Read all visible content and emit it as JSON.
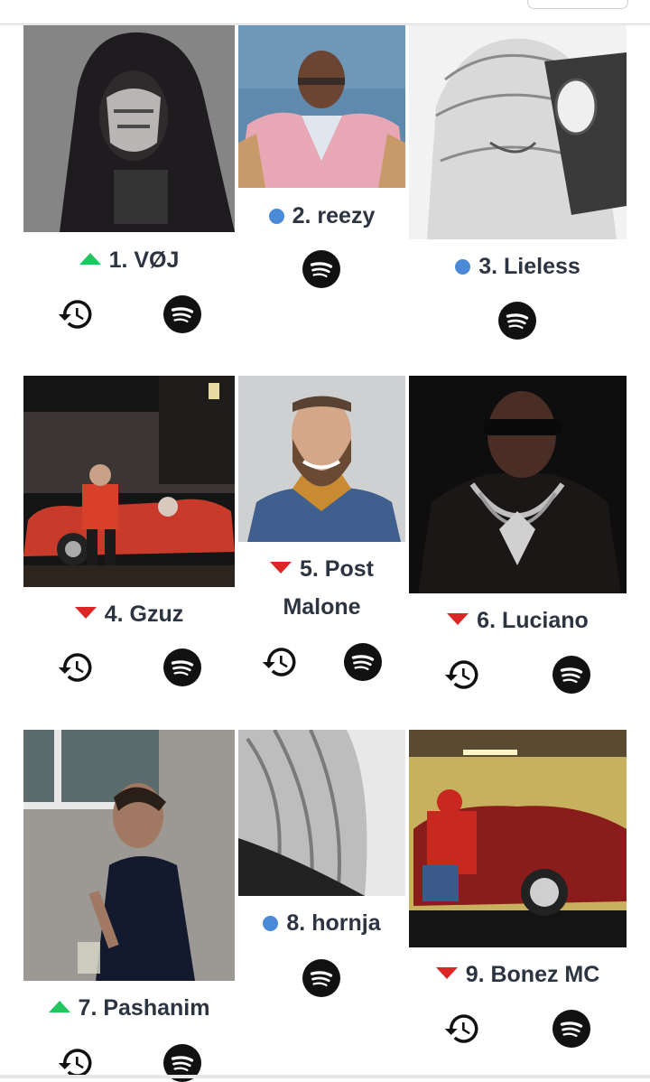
{
  "colors": {
    "trend_up": "#22c55e",
    "trend_down": "#dc2626",
    "trend_same": "#4a8ad6",
    "label_text": "#2b3440"
  },
  "artists": [
    {
      "rank_label": "1. VØJ",
      "trend": "up",
      "has_history": true,
      "photo_desc": "hooded-masked-artist",
      "history_icon": "history-icon",
      "spotify_icon": "spotify-icon"
    },
    {
      "rank_label": "2. reezy",
      "trend": "same",
      "has_history": false,
      "photo_desc": "artist-pink-jacket",
      "spotify_icon": "spotify-icon"
    },
    {
      "rank_label": "3. Lieless",
      "trend": "same",
      "has_history": false,
      "photo_desc": "manga-style-drawing",
      "spotify_icon": "spotify-icon"
    },
    {
      "rank_label": "4. Gzuz",
      "trend": "down",
      "has_history": true,
      "photo_desc": "artist-red-car-night",
      "history_icon": "history-icon",
      "spotify_icon": "spotify-icon"
    },
    {
      "rank_label": "5. Post Malone",
      "trend": "down",
      "has_history": true,
      "photo_desc": "bearded-artist-denim",
      "history_icon": "history-icon",
      "spotify_icon": "spotify-icon"
    },
    {
      "rank_label": "6. Luciano",
      "trend": "down",
      "has_history": true,
      "photo_desc": "artist-sunglasses-chains",
      "history_icon": "history-icon",
      "spotify_icon": "spotify-icon"
    },
    {
      "rank_label": "7. Pashanim",
      "trend": "up",
      "has_history": true,
      "photo_desc": "artist-profile-street",
      "history_icon": "history-icon",
      "spotify_icon": "spotify-icon"
    },
    {
      "rank_label": "8. hornja",
      "trend": "same",
      "has_history": false,
      "photo_desc": "blonde-hair-bw",
      "spotify_icon": "spotify-icon"
    },
    {
      "rank_label": "9. Bonez MC",
      "trend": "down",
      "has_history": true,
      "photo_desc": "artist-red-convertible-garage",
      "history_icon": "history-icon",
      "spotify_icon": "spotify-icon"
    }
  ]
}
